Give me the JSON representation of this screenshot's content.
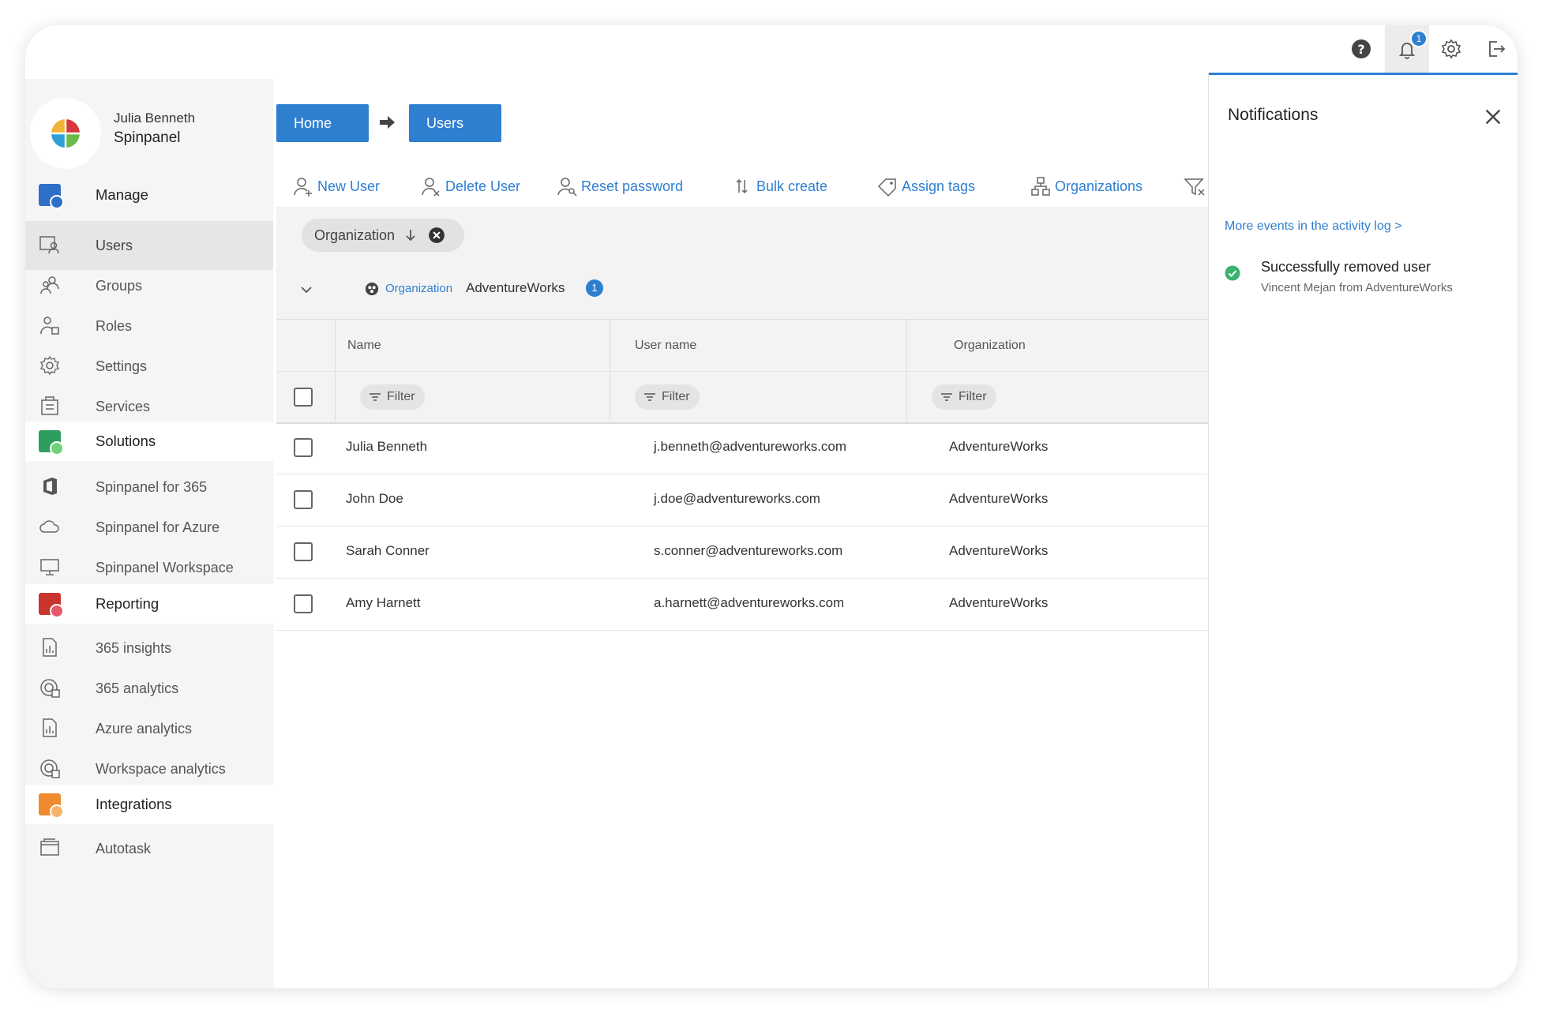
{
  "profile": {
    "name": "Julia Benneth",
    "org": "Spinpanel"
  },
  "sidebar": {
    "items": [
      {
        "label": "Manage",
        "icon": "manage-app-icon"
      },
      {
        "label": "Users",
        "icon": "users-icon"
      },
      {
        "label": "Groups",
        "icon": "groups-icon"
      },
      {
        "label": "Roles",
        "icon": "roles-icon"
      },
      {
        "label": "Settings",
        "icon": "gear-icon"
      },
      {
        "label": "Services",
        "icon": "services-icon"
      },
      {
        "label": "Solutions",
        "icon": "solutions-app-icon"
      },
      {
        "label": "Spinpanel for 365",
        "icon": "office-icon"
      },
      {
        "label": "Spinpanel for Azure",
        "icon": "cloud-icon"
      },
      {
        "label": "Spinpanel Workspace",
        "icon": "monitor-icon"
      },
      {
        "label": "Reporting",
        "icon": "reporting-app-icon"
      },
      {
        "label": "365 insights",
        "icon": "report-icon"
      },
      {
        "label": "365 analytics",
        "icon": "analytics-icon"
      },
      {
        "label": "Azure analytics",
        "icon": "report-icon"
      },
      {
        "label": "Workspace analytics",
        "icon": "analytics-icon"
      },
      {
        "label": "Integrations",
        "icon": "integrations-app-icon"
      },
      {
        "label": "Autotask",
        "icon": "autotask-icon"
      }
    ]
  },
  "topbar": {
    "notification_count": "1"
  },
  "breadcrumb": {
    "home": "Home",
    "current": "Users"
  },
  "toolbar": {
    "new_user": "New User",
    "delete_user": "Delete User",
    "reset_password": "Reset password",
    "bulk_create": "Bulk create",
    "assign_tags": "Assign tags",
    "organizations": "Organizations"
  },
  "grouping": {
    "chip_label": "Organization",
    "group_field": "Organization",
    "group_value": "AdventureWorks",
    "group_count": "1"
  },
  "table": {
    "columns": [
      "Name",
      "User name",
      "Organization"
    ],
    "filter_label": "Filter",
    "rows": [
      {
        "name": "Julia Benneth",
        "username": "j.benneth@adventureworks.com",
        "organization": "AdventureWorks"
      },
      {
        "name": "John Doe",
        "username": "j.doe@adventureworks.com",
        "organization": "AdventureWorks"
      },
      {
        "name": "Sarah Conner",
        "username": "s.conner@adventureworks.com",
        "organization": "AdventureWorks"
      },
      {
        "name": "Amy Harnett",
        "username": "a.harnett@adventureworks.com",
        "organization": "AdventureWorks"
      }
    ]
  },
  "notifications": {
    "title": "Notifications",
    "activity_link": "More events in the activity log >",
    "items": [
      {
        "title": "Successfully removed user",
        "detail": "Vincent Mejan from AdventureWorks"
      }
    ]
  },
  "colors": {
    "accent": "#2f7fd0",
    "success": "#3cb371",
    "manage": "#2f6fc7",
    "solutions": "#2e9e5e",
    "reporting": "#c9342f",
    "integrations": "#ef8a2e"
  }
}
